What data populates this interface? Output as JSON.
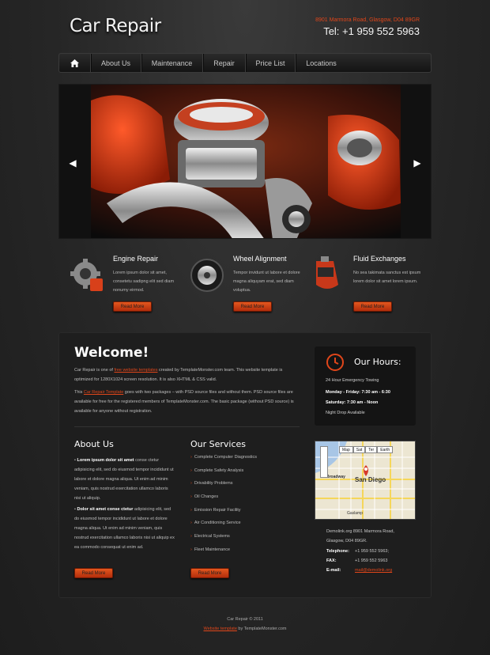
{
  "header": {
    "logo": "Car Repair",
    "address": "8901 Marmora Road, Glasgow, D04 89GR",
    "tel": "Tel: +1 959 552 5963"
  },
  "nav": {
    "items": [
      "About Us",
      "Maintenance",
      "Repair",
      "Price List",
      "Locations"
    ]
  },
  "features": [
    {
      "title": "Engine Repair",
      "text": "Lorem ipsum dolor sit amet, consetetu sadipng elit sed diam nonumy eirmod.",
      "button": "Read More"
    },
    {
      "title": "Wheel Alignment",
      "text": "Tempor invidunt ut labore et dolore magna aliquyam erat, sed diam voluptua.",
      "button": "Read More"
    },
    {
      "title": "Fluid Exchanges",
      "text": "No sea takimata sanctus est ipsum lorem dolor sit amet lorem ipsum.",
      "button": "Read More"
    }
  ],
  "welcome": {
    "title": "Welcome!",
    "p1_a": "Car Repair is one of ",
    "p1_link": "free website templates",
    "p1_b": " created by TemplateMonster.com team. This website template is optimized for 1280X1024 screen resolution. It is also XHTML & CSS valid.",
    "p2_a": "This ",
    "p2_link": "Car Repair Template",
    "p2_b": " goes with two packages – with PSD source files and without them. PSD source files are available for free for the registered members of TemplateMonster.com. The basic package (without PSD source) is available for anyone without registration."
  },
  "about": {
    "title": "About Us",
    "p1_bold": "Lorem ipsum dolor sit amet",
    "p1_text": " conse ctetur adipisicing elit, sed do eiusmod tempor incididunt ut labore et dolore magna aliqua. Ut enim ad minim veniam, quis nostrud exercitation ullamco laboris nisi ut aliquip.",
    "p2_bold": "Dolor sit amet conse ctetur",
    "p2_text": " adipisicing elit, sed do eiusmod tempor incididunt ut labore et dolore magna aliqua. Ut enim ad minim veniam, quis nostrud exercitation ullamco laboris nisi ut aliquip ex ea commodo consequat ut enim ad.",
    "button": "Read More"
  },
  "services": {
    "title": "Our Services",
    "items": [
      "Complete Computer Diagnostics",
      "Complete Safety Analysis",
      "Drivability Problems",
      "Oil Changes",
      "Emission Repair Facility",
      "Air Conditioning Service",
      "Electrical Systems",
      "Fleet Maintenance"
    ],
    "button": "Read More"
  },
  "hours": {
    "title": "Our Hours:",
    "line1": "24 Hour Emergency Towing",
    "line2_label": "Monday - Friday:",
    "line2_value": " 7:30 am - 6:30",
    "line3_label": "Saturday:",
    "line3_value": " 7:30 am - Noon",
    "line4": "Night Drop Available"
  },
  "map": {
    "buttons": [
      "Map",
      "Sat",
      "Ter",
      "Earth"
    ],
    "city": "San Diego",
    "street": "Broadway",
    "area": "Gaslamp"
  },
  "contact": {
    "address1": "Demolink.org 8901 Marmora Road,",
    "address2": "Glasgow, D04 89GR.",
    "phone_label": "Telephone:",
    "phone": "+1 959 552 5963;",
    "fax_label": "FAX:",
    "fax": "+1 959 552 5963",
    "email_label": "E-mail:",
    "email": "mail@demolink.org"
  },
  "footer": {
    "line1": "Car Repair © 2011",
    "link": "Website template",
    "line2": " by TemplateMonster.com"
  },
  "colors": {
    "accent": "#e0461a",
    "background": "#262626",
    "panel": "#1e1e1e"
  }
}
